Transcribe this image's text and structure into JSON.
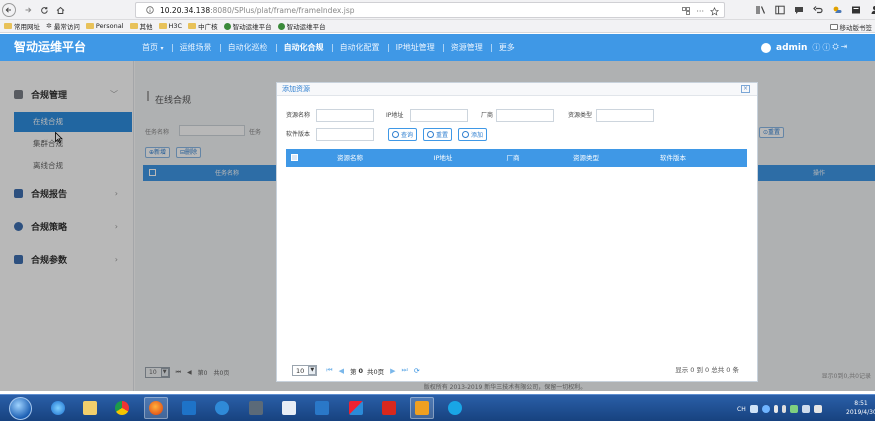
{
  "browser": {
    "url_host": "10.20.34.138",
    "url_rest": ":8080/SPlus/plat/frame/frameIndex.jsp",
    "url_menu_glyph": "···",
    "bookmarks": [
      "常用网址",
      "最常访问",
      "Personal",
      "其他",
      "H3C",
      "中广核",
      "智动运维平台",
      "智动运维平台"
    ],
    "mobile_bookmarks": "移动版书签"
  },
  "app": {
    "brand": "智动运维平台",
    "nav": [
      "首页",
      "运维场景",
      "自动化巡检",
      "自动化合规",
      "自动化配置",
      "IP地址管理",
      "资源管理",
      "更多"
    ],
    "nav_home_caret": "▾",
    "active_nav": "自动化合规",
    "user": "admin",
    "accent_color": "#3f98e6"
  },
  "sidebar": {
    "groups": [
      {
        "label": "合规管理",
        "icon": "compliance-mgmt-icon",
        "color": "#7a7f87"
      },
      {
        "label": "合规报告",
        "icon": "report-icon",
        "color": "#3f6fb0"
      },
      {
        "label": "合规策略",
        "icon": "policy-icon",
        "color": "#3f6fb0"
      },
      {
        "label": "合规参数",
        "icon": "params-icon",
        "color": "#3f6fb0"
      }
    ],
    "sub_items": [
      "在线合规",
      "集群合规",
      "离线合规"
    ],
    "active_sub": "在线合规"
  },
  "background_page": {
    "title": "在线合规",
    "task_name_label": "任务名称",
    "task_label_short": "任务",
    "col_task": "任务名称",
    "col_op": "操作",
    "btn_add": "新增",
    "btn_delete": "删除",
    "btn_search": "查询",
    "btn_reset": "重置",
    "page_size": "10",
    "page_text": "第0",
    "page_total": "共0页",
    "summary": "显示0到0,共0记录"
  },
  "dialog": {
    "title": "添加资源",
    "close": "×",
    "fields": {
      "resource_name": {
        "label": "资源名称",
        "value": ""
      },
      "ip": {
        "label": "IP地址",
        "value": ""
      },
      "vendor": {
        "label": "厂商",
        "value": ""
      },
      "resource_type": {
        "label": "资源类型",
        "value": ""
      },
      "software_version": {
        "label": "软件版本",
        "value": ""
      }
    },
    "buttons": {
      "query": "查询",
      "reset": "重置",
      "add": "添加"
    },
    "table": {
      "columns": [
        "资源名称",
        "IP地址",
        "厂商",
        "资源类型",
        "软件版本"
      ],
      "rows": []
    },
    "pager": {
      "page_size": "10",
      "page_label": "第",
      "page_value": "0",
      "page_total": "共0页",
      "summary": "显示 0 到 0 总共 0 条"
    }
  },
  "footer": "版权所有 2013-2019 新华三技术有限公司，保留一切权利。",
  "taskbar": {
    "time": "8:51",
    "date": "2019/4/30",
    "tray_text": "CH"
  }
}
